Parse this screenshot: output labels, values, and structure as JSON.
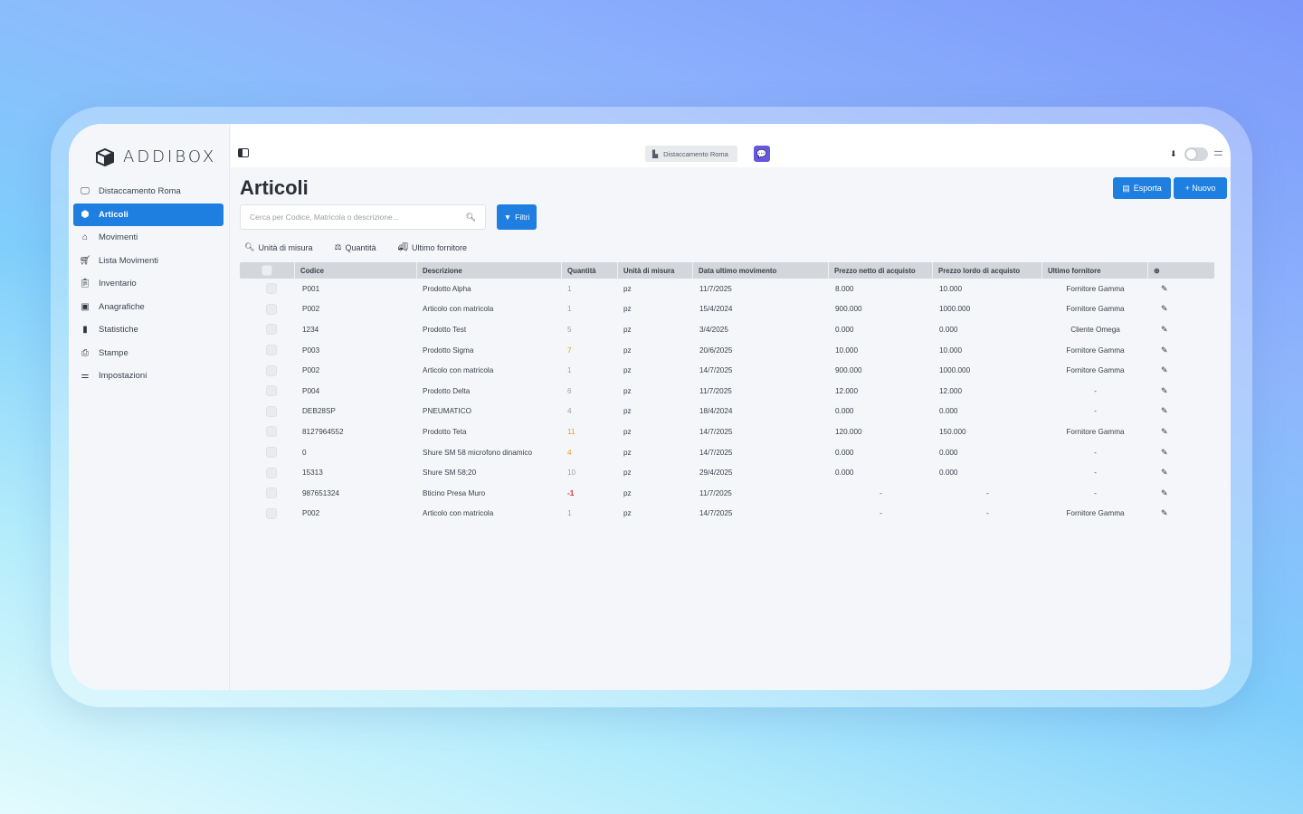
{
  "app": {
    "brand": "ADDIBOX"
  },
  "sidebar": {
    "items": [
      {
        "label": "Distaccamento Roma",
        "icon": "monitor-icon",
        "active": false
      },
      {
        "label": "Articoli",
        "icon": "box-icon",
        "active": true
      },
      {
        "label": "Movimenti",
        "icon": "warehouse-icon",
        "active": false
      },
      {
        "label": "Lista Movimenti",
        "icon": "cart-icon",
        "active": false
      },
      {
        "label": "Inventario",
        "icon": "clipboard-icon",
        "active": false
      },
      {
        "label": "Anagrafiche",
        "icon": "id-card-icon",
        "active": false
      },
      {
        "label": "Statistiche",
        "icon": "bar-chart-icon",
        "active": false
      },
      {
        "label": "Stampe",
        "icon": "print-icon",
        "active": false
      },
      {
        "label": "Impostazioni",
        "icon": "sliders-icon",
        "active": false
      }
    ]
  },
  "topbar": {
    "location": "Distaccamento Roma"
  },
  "page": {
    "title": "Articoli",
    "export_label": "Esporta",
    "new_label": "+ Nuovo",
    "search_placeholder": "Cerca per Codice, Matricola o descrizione...",
    "filter_label": "Filtri"
  },
  "chips": [
    {
      "label": "Unità di misura",
      "icon": "search-icon"
    },
    {
      "label": "Quantità",
      "icon": "scale-icon"
    },
    {
      "label": "Ultimo fornitore",
      "icon": "truck-icon"
    }
  ],
  "table": {
    "headers": [
      "Codice",
      "Descrizione",
      "Quantità",
      "Unità di misura",
      "Data ultimo movimento",
      "Prezzo netto di acquisto",
      "Prezzo lordo di acquisto",
      "Ultimo fornitore"
    ],
    "rows": [
      {
        "codice": "P001",
        "descrizione": "Prodotto Alpha",
        "quantita": "1",
        "qty_style": "normal",
        "um": "pz",
        "data": "11/7/2025",
        "netto": "8.000",
        "lordo": "10.000",
        "fornitore": "Fornitore Gamma"
      },
      {
        "codice": "P002",
        "descrizione": "Articolo con matricola",
        "quantita": "1",
        "qty_style": "normal",
        "um": "pz",
        "data": "15/4/2024",
        "netto": "900.000",
        "lordo": "1000.000",
        "fornitore": "Fornitore Gamma"
      },
      {
        "codice": "1234",
        "descrizione": "Prodotto Test",
        "quantita": "5",
        "qty_style": "normal",
        "um": "pz",
        "data": "3/4/2025",
        "netto": "0.000",
        "lordo": "0.000",
        "fornitore": "Cliente Omega"
      },
      {
        "codice": "P003",
        "descrizione": "Prodotto Sigma",
        "quantita": "7",
        "qty_style": "orange",
        "um": "pz",
        "data": "20/6/2025",
        "netto": "10.000",
        "lordo": "10.000",
        "fornitore": "Fornitore Gamma"
      },
      {
        "codice": "P002",
        "descrizione": "Articolo con matricola",
        "quantita": "1",
        "qty_style": "normal",
        "um": "pz",
        "data": "14/7/2025",
        "netto": "900.000",
        "lordo": "1000.000",
        "fornitore": "Fornitore Gamma"
      },
      {
        "codice": "P004",
        "descrizione": "Prodotto Delta",
        "quantita": "6",
        "qty_style": "normal",
        "um": "pz",
        "data": "11/7/2025",
        "netto": "12.000",
        "lordo": "12.000",
        "fornitore": "-"
      },
      {
        "codice": "DEB28SP",
        "descrizione": "PNEUMATICO",
        "quantita": "4",
        "qty_style": "normal",
        "um": "pz",
        "data": "18/4/2024",
        "netto": "0.000",
        "lordo": "0.000",
        "fornitore": "-"
      },
      {
        "codice": "8127964552",
        "descrizione": "Prodotto Teta",
        "quantita": "11",
        "qty_style": "orange",
        "um": "pz",
        "data": "14/7/2025",
        "netto": "120.000",
        "lordo": "150.000",
        "fornitore": "Fornitore Gamma"
      },
      {
        "codice": "0",
        "descrizione": "Shure SM 58 microfono dinamico",
        "quantita": "4",
        "qty_style": "orange",
        "um": "pz",
        "data": "14/7/2025",
        "netto": "0.000",
        "lordo": "0.000",
        "fornitore": "-"
      },
      {
        "codice": "15313",
        "descrizione": "Shure SM 58;20",
        "quantita": "10",
        "qty_style": "normal",
        "um": "pz",
        "data": "29/4/2025",
        "netto": "0.000",
        "lordo": "0.000",
        "fornitore": "-"
      },
      {
        "codice": "987651324",
        "descrizione": "Bticino Presa Muro",
        "quantita": "-1",
        "qty_style": "red",
        "um": "pz",
        "data": "11/7/2025",
        "netto": "-",
        "lordo": "-",
        "fornitore": "-"
      },
      {
        "codice": "P002",
        "descrizione": "Articolo con matricola",
        "quantita": "1",
        "qty_style": "normal",
        "um": "pz",
        "data": "14/7/2025",
        "netto": "-",
        "lordo": "-",
        "fornitore": "Fornitore Gamma"
      }
    ]
  },
  "colors": {
    "accent": "#1e7fe0",
    "chat": "#6458e0",
    "qty_warning": "#f29a14",
    "qty_negative": "#e02a2a"
  }
}
